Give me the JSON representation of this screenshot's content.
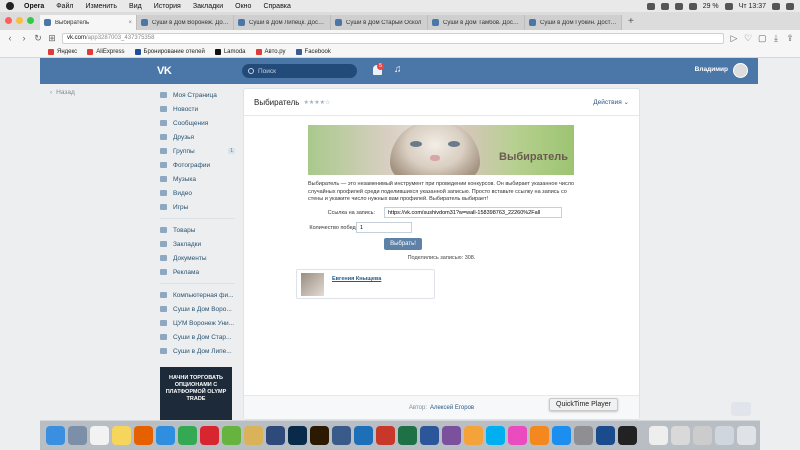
{
  "menubar": {
    "app": "Opera",
    "items": [
      "Файл",
      "Изменить",
      "Вид",
      "История",
      "Закладки",
      "Окно",
      "Справка"
    ],
    "battery": "29 %",
    "time": "Чт 13:37"
  },
  "browser": {
    "tabs": [
      {
        "title": "Выбиратель",
        "active": true
      },
      {
        "title": "Суши в Дом Воронеж. Доста",
        "active": false
      },
      {
        "title": "Суши в Дом Липецк. Достав",
        "active": false
      },
      {
        "title": "Суши в Дом Старый Оскол",
        "active": false
      },
      {
        "title": "Суши в Дом Тамбов. Доставк",
        "active": false
      },
      {
        "title": "Суши в Дом Губкин. Доставк",
        "active": false
      }
    ],
    "new_tab": "+",
    "url_host": "vk.com",
    "url_path": "/app3287003_437375358",
    "bookmarks": [
      {
        "label": "Яндекс",
        "color": "#e53935"
      },
      {
        "label": "AliExpress",
        "color": "#e53935"
      },
      {
        "label": "Бронирование отелей",
        "color": "#1e4f9c"
      },
      {
        "label": "Lamoda",
        "color": "#111111"
      },
      {
        "label": "Авто.ру",
        "color": "#e53935"
      },
      {
        "label": "Facebook",
        "color": "#3b5998"
      }
    ]
  },
  "vk": {
    "search_placeholder": "Поиск",
    "notif_count": "5",
    "user_name": "Владимир",
    "back_label": "Назад",
    "menu": [
      {
        "label": "Моя Страница"
      },
      {
        "label": "Новости"
      },
      {
        "label": "Сообщения"
      },
      {
        "label": "Друзья"
      },
      {
        "label": "Группы",
        "count": "1"
      },
      {
        "label": "Фотографии"
      },
      {
        "label": "Музыка"
      },
      {
        "label": "Видео"
      },
      {
        "label": "Игры"
      }
    ],
    "menu2": [
      {
        "label": "Товары"
      },
      {
        "label": "Закладки"
      },
      {
        "label": "Документы"
      },
      {
        "label": "Реклама"
      }
    ],
    "groups": [
      {
        "label": "Компьютерная фи..."
      },
      {
        "label": "Суши в Дом Воро..."
      },
      {
        "label": "ЦУМ Воронеж Уни..."
      },
      {
        "label": "Суши в Дом Стар..."
      },
      {
        "label": "Суши в Дом Липе..."
      }
    ],
    "ad_text": "НАЧНИ ТОРГОВАТЬ ОПЦИОНАМИ С ПЛАТФОРМОЙ OLYMP TRADE"
  },
  "app": {
    "title": "Выбиратель",
    "stars": "★★★★☆",
    "actions": "Действия",
    "banner_text": "Выбиратель",
    "description": "Выбиратель — это незаменимый инструмент при проведении конкурсов. Он выбирает указанное число случайных профилей среди поделившихся указанной записью. Просто вставьте ссылку на запись со стены и укажите число нужных вам профилей. Выбиратель выбирает!",
    "link_label": "Ссылка на запись:",
    "link_value": "https://vk.com/sushivdom31?w=wall-158398763_22260%2Fall",
    "winners_label": "Количество победителей:",
    "winners_value": "1",
    "pick_button": "Выбрать!",
    "shared_text": "Поделились записью: 308.",
    "winner_name": "Евгения Кныщева",
    "footer_prefix": "Автор:",
    "footer_author": "Алексей Егоров"
  },
  "tooltip": "QuickTime Player",
  "dock": {
    "icons": [
      {
        "name": "finder-icon",
        "color": "#3b8fe0"
      },
      {
        "name": "launchpad-icon",
        "color": "#7c8fa8"
      },
      {
        "name": "calendar-icon",
        "color": "#f2f2f2"
      },
      {
        "name": "notes-icon",
        "color": "#f6d55c"
      },
      {
        "name": "firefox-icon",
        "color": "#e66000"
      },
      {
        "name": "safari-icon",
        "color": "#2f8ee0"
      },
      {
        "name": "chrome-icon",
        "color": "#34a853"
      },
      {
        "name": "opera-icon",
        "color": "#d7262f"
      },
      {
        "name": "utorrent-icon",
        "color": "#66b43f"
      },
      {
        "name": "archive-icon",
        "color": "#d9b25a"
      },
      {
        "name": "photo-icon",
        "color": "#2e4a7a"
      },
      {
        "name": "photoshop-icon",
        "color": "#0a2a4a"
      },
      {
        "name": "illustrator-icon",
        "color": "#2b1a00"
      },
      {
        "name": "app-icon",
        "color": "#3a5a8a"
      },
      {
        "name": "table-icon",
        "color": "#1d6fb8"
      },
      {
        "name": "pdf-icon",
        "color": "#c7372a"
      },
      {
        "name": "excel-icon",
        "color": "#1e7145"
      },
      {
        "name": "word-icon",
        "color": "#2b579a"
      },
      {
        "name": "viber-icon",
        "color": "#7b519d"
      },
      {
        "name": "photos-icon",
        "color": "#f3a33a"
      },
      {
        "name": "skype-icon",
        "color": "#00aff0"
      },
      {
        "name": "itunes-icon",
        "color": "#ea4cc0"
      },
      {
        "name": "ibooks-icon",
        "color": "#f5871f"
      },
      {
        "name": "appstore-icon",
        "color": "#1c8ef0"
      },
      {
        "name": "settings-icon",
        "color": "#8e8e93"
      },
      {
        "name": "quicktime-icon",
        "color": "#1a4b8c"
      },
      {
        "name": "activity-monitor-icon",
        "color": "#222222"
      },
      {
        "name": "document-icon",
        "color": "#eeeeee"
      },
      {
        "name": "screenshot-icon",
        "color": "#d9d9d9"
      },
      {
        "name": "folder-icon",
        "color": "#cccccc"
      },
      {
        "name": "downloads-icon",
        "color": "#cfd6de"
      },
      {
        "name": "trash-icon",
        "color": "#dfe3e8"
      }
    ]
  }
}
